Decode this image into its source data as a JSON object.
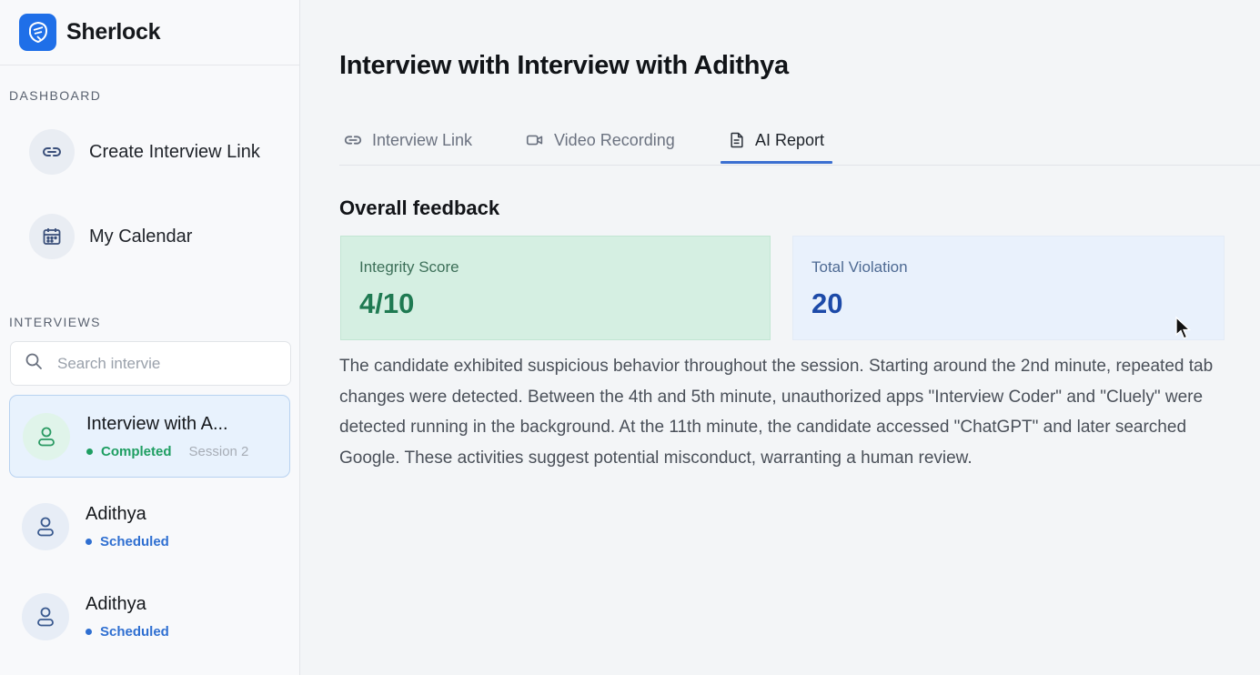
{
  "app": {
    "name": "Sherlock",
    "logo_icon": "sherlock-logo-icon",
    "accent": "#1f6fe8"
  },
  "sidebar": {
    "dashboard_title": "DASHBOARD",
    "nav": [
      {
        "label": "Create Interview Link",
        "icon": "link-icon"
      },
      {
        "label": "My Calendar",
        "icon": "calendar-icon"
      }
    ],
    "interviews_title": "INTERVIEWS",
    "search_placeholder": "Search intervie",
    "interviews": [
      {
        "name": "Interview with A...",
        "status": "Completed",
        "session": "Session 2",
        "status_color": "#1e9e62",
        "active": true
      },
      {
        "name": "Adithya",
        "status": "Scheduled",
        "status_color": "#2f6fd1",
        "active": false
      },
      {
        "name": "Adithya",
        "status": "Scheduled",
        "status_color": "#2f6fd1",
        "active": false
      }
    ]
  },
  "main": {
    "title": "Interview with Interview with Adithya",
    "tabs": [
      {
        "label": "Interview Link",
        "icon": "link-icon"
      },
      {
        "label": "Video Recording",
        "icon": "video-icon"
      },
      {
        "label": "AI Report",
        "icon": "report-icon",
        "active": true
      }
    ],
    "section_title": "Overall feedback",
    "cards": {
      "integrity": {
        "label": "Integrity Score",
        "value": "4/10",
        "color": "#1f7a52"
      },
      "violation": {
        "label": "Total Violation",
        "value": "20",
        "color": "#1d4aa8"
      }
    },
    "summary": "The candidate exhibited suspicious behavior throughout the session. Starting around the 2nd minute, repeated tab changes were detected. Between the 4th and 5th minute, unauthorized apps \"Interview Coder\" and \"Cluely\" were detected running in the background. At the 11th minute, the candidate accessed \"ChatGPT\" and later searched Google. These activities suggest potential misconduct, warranting a human review."
  }
}
